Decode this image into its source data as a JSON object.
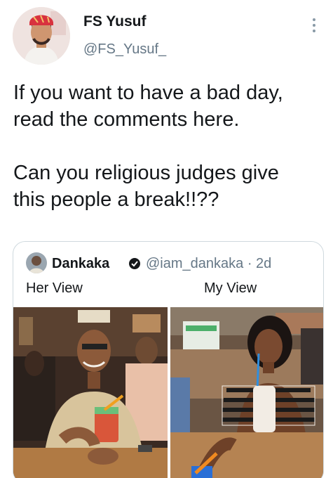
{
  "tweet": {
    "author_name": "FS Yusuf",
    "author_handle": "@FS_Yusuf_",
    "text": "If you want to have a bad day,\nread the comments here.\n\nCan you religious judges give\nthis people a break!!??"
  },
  "quoted_tweet": {
    "author_name": "Dankaka",
    "author_handle": "@iam_dankaka · 2d",
    "caption_left": "Her View",
    "caption_right": "My View"
  },
  "icons": {
    "more": "more-vertical-icon",
    "verified": "verified-badge-icon"
  },
  "colors": {
    "text": "#14171a",
    "secondary": "#657786",
    "border": "#cfd9de"
  }
}
